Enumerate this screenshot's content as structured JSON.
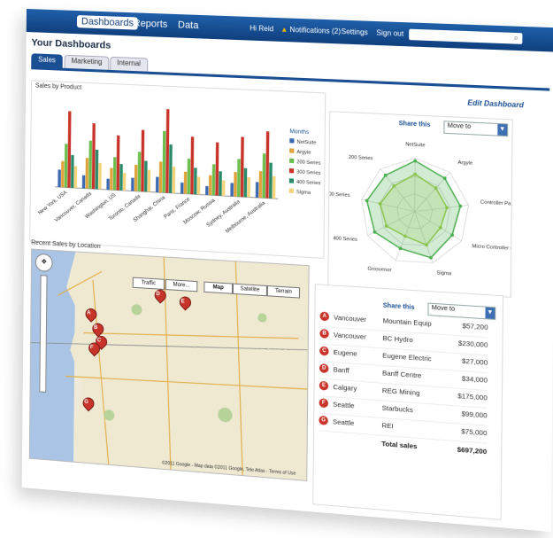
{
  "nav": {
    "items": [
      "Dashboards",
      "Reports",
      "Data"
    ],
    "greeting": "Hi Reid",
    "notifications": "Notifications (2)",
    "settings": "Settings",
    "signout": "Sign out"
  },
  "page_title": "Your Dashboards",
  "tabs": [
    "Sales",
    "Marketing",
    "Internal"
  ],
  "edit_dashboard": "Edit Dashboard",
  "bar_panel": {
    "title": "Sales by Product",
    "legend_title": "Months",
    "categories": [
      "New York, USA",
      "Vancouver, Canada",
      "Washington, US",
      "Toronto, Canada",
      "Shanghai, China",
      "Paris, France",
      "Moscow, Russia",
      "Sydney, Australia",
      "Melbourne, Australia"
    ],
    "series": [
      {
        "name": "NetSuite",
        "color": "#3b6ab0",
        "values": [
          8,
          6,
          5,
          6,
          7,
          5,
          4,
          6,
          7
        ]
      },
      {
        "name": "Argyle",
        "color": "#e0a23a",
        "values": [
          12,
          14,
          10,
          12,
          14,
          10,
          9,
          11,
          12
        ]
      },
      {
        "name": "200 Series",
        "color": "#6bbf4e",
        "values": [
          20,
          22,
          15,
          18,
          28,
          16,
          14,
          17,
          20
        ]
      },
      {
        "name": "300 Series",
        "color": "#c8342a",
        "values": [
          35,
          30,
          25,
          28,
          38,
          26,
          24,
          27,
          30
        ]
      },
      {
        "name": "400 Series",
        "color": "#2a8a6a",
        "values": [
          15,
          18,
          12,
          14,
          22,
          12,
          11,
          13,
          16
        ]
      },
      {
        "name": "Sigma",
        "color": "#f5d37a",
        "values": [
          10,
          12,
          8,
          10,
          12,
          8,
          7,
          9,
          10
        ]
      }
    ]
  },
  "radar_panel": {
    "share": "Share this",
    "move_to": "Move to",
    "axes": [
      "NetSuite",
      "Argyle",
      "Controller Package",
      "Micro Controller Centre",
      "Sigma",
      "Grosvenor",
      "400 Series",
      "300 Series",
      "200 Series"
    ],
    "outer": [
      0.95,
      0.85,
      0.85,
      0.8,
      0.9,
      0.75,
      0.85,
      0.9,
      0.85
    ],
    "inner": [
      0.7,
      0.6,
      0.6,
      0.55,
      0.65,
      0.5,
      0.6,
      0.65,
      0.6
    ]
  },
  "map_panel": {
    "title": "Recent Sales by Location",
    "buttons": [
      "Traffic",
      "More...",
      "Map",
      "Satellite",
      "Terrain"
    ],
    "copyright": "©2011 Google - Map data ©2011 Google, Tele Atlas - Terms of Use",
    "pins": [
      "A",
      "B",
      "C",
      "D",
      "E",
      "F",
      "G"
    ]
  },
  "sales_panel": {
    "share": "Share this",
    "move_to": "Move to",
    "rows": [
      {
        "marker": "A",
        "city": "Vancouver",
        "company": "Mountain Equip",
        "amount": "$57,200"
      },
      {
        "marker": "B",
        "city": "Vancouver",
        "company": "BC Hydro",
        "amount": "$230,000"
      },
      {
        "marker": "C",
        "city": "Eugene",
        "company": "Eugene Electric",
        "amount": "$27,000"
      },
      {
        "marker": "D",
        "city": "Banff",
        "company": "Banff Centre",
        "amount": "$34,000"
      },
      {
        "marker": "E",
        "city": "Calgary",
        "company": "REG Mining",
        "amount": "$175,000"
      },
      {
        "marker": "F",
        "city": "Seattle",
        "company": "Starbucks",
        "amount": "$99,000"
      },
      {
        "marker": "G",
        "city": "Seattle",
        "company": "REI",
        "amount": "$75,000"
      }
    ],
    "total_label": "Total sales",
    "total": "$697,200"
  }
}
